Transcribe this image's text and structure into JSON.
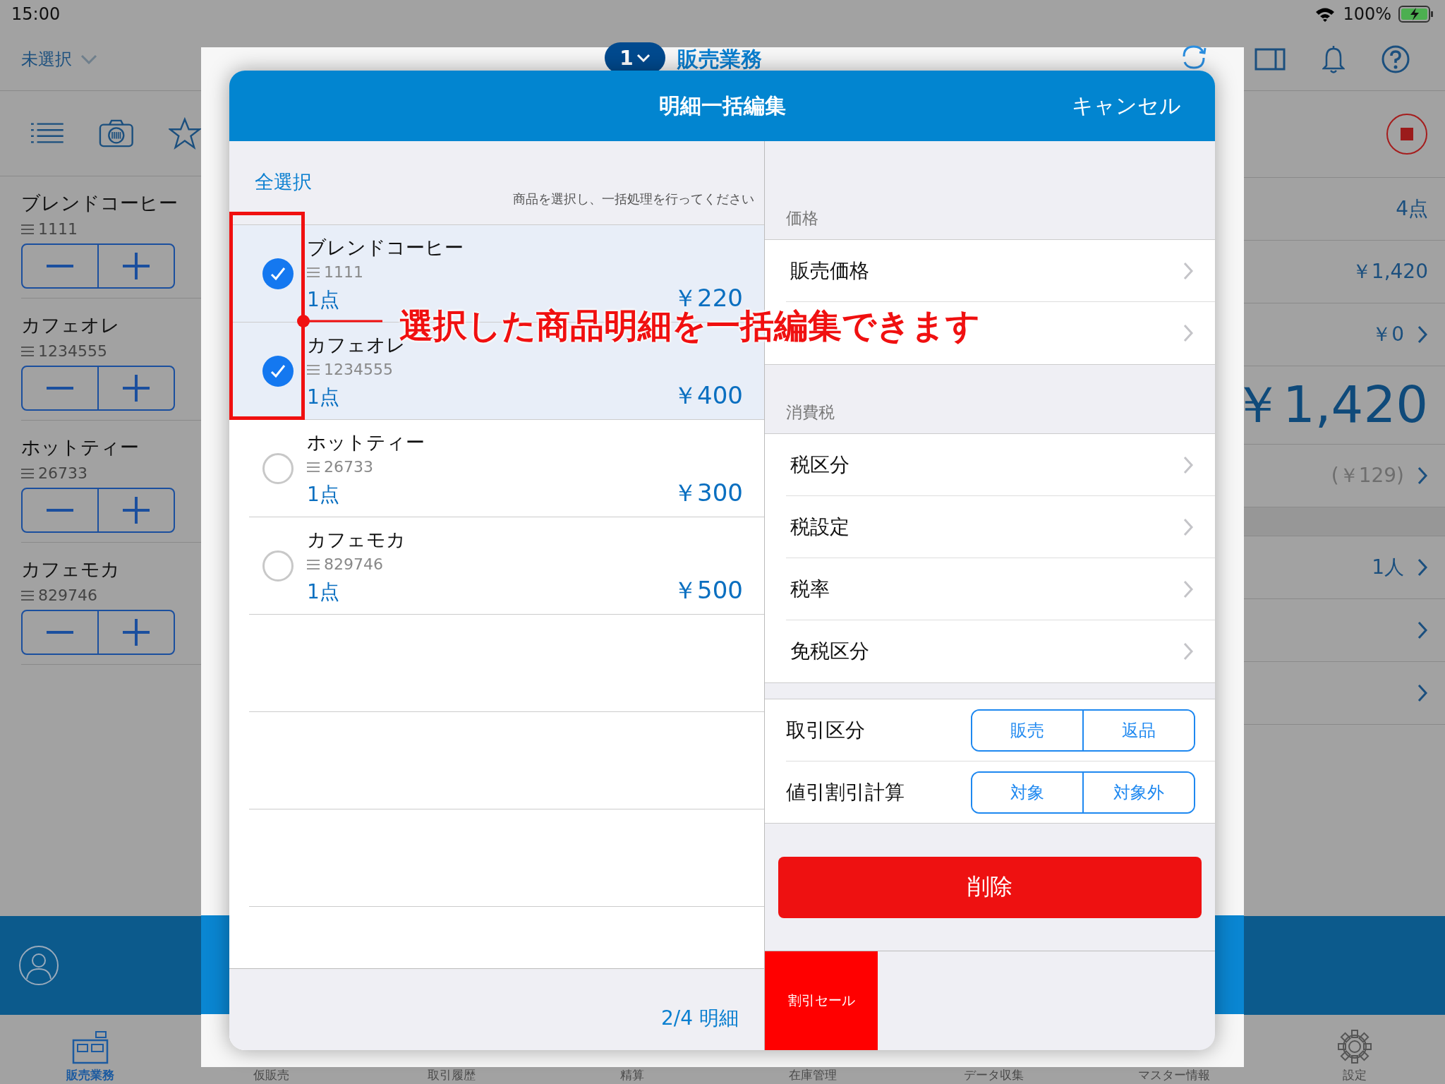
{
  "status_bar": {
    "time": "15:00",
    "battery": "100%"
  },
  "background": {
    "nav": {
      "store": "未選択",
      "register_number": "1",
      "title": "販売業務"
    },
    "items": [
      {
        "name": "ブレンドコーヒー",
        "code": "1111"
      },
      {
        "name": "カフェオレ",
        "code": "1234555"
      },
      {
        "name": "ホットティー",
        "code": "26733"
      },
      {
        "name": "カフェモカ",
        "code": "829746"
      }
    ],
    "summary": [
      {
        "kind": "plain",
        "value": "4点"
      },
      {
        "kind": "plain",
        "value": "￥1,420"
      },
      {
        "kind": "link",
        "value": "￥0"
      },
      {
        "kind": "total",
        "value": "￥1,420"
      },
      {
        "kind": "muted_link",
        "value": "(￥129)"
      },
      {
        "kind": "spacer"
      },
      {
        "kind": "link",
        "value": "1人"
      },
      {
        "kind": "link"
      },
      {
        "kind": "link"
      }
    ],
    "tabs": [
      {
        "label": "販売業務",
        "selected": true
      },
      {
        "label": "仮販売",
        "selected": false
      },
      {
        "label": "取引履歴",
        "selected": false
      },
      {
        "label": "精算",
        "selected": false
      },
      {
        "label": "在庫管理",
        "selected": false
      },
      {
        "label": "データ収集",
        "selected": false
      },
      {
        "label": "マスター情報",
        "selected": false
      },
      {
        "label": "設定",
        "selected": false
      }
    ]
  },
  "modal": {
    "title": "明細一括編集",
    "cancel": "キャンセル",
    "select_all": "全選択",
    "hint": "商品を選択し、一括処理を行ってください",
    "lines": [
      {
        "name": "ブレンドコーヒー",
        "code": "1111",
        "quantity": "1点",
        "price": "￥220",
        "selected": true
      },
      {
        "name": "カフェオレ",
        "code": "1234555",
        "quantity": "1点",
        "price": "￥400",
        "selected": true
      },
      {
        "name": "ホットティー",
        "code": "26733",
        "quantity": "1点",
        "price": "￥300",
        "selected": false
      },
      {
        "name": "カフェモカ",
        "code": "829746",
        "quantity": "1点",
        "price": "￥500",
        "selected": false
      }
    ],
    "footer": "2/4 明細",
    "sections": [
      {
        "header": "価格",
        "rows": [
          {
            "kind": "link",
            "label": "販売価格"
          },
          {
            "kind": "link"
          }
        ]
      },
      {
        "header": "消費税",
        "rows": [
          {
            "kind": "link",
            "label": "税区分"
          },
          {
            "kind": "link",
            "label": "税設定"
          },
          {
            "kind": "link",
            "label": "税率"
          },
          {
            "kind": "link",
            "label": "免税区分"
          }
        ]
      }
    ],
    "segments": [
      {
        "label": "取引区分",
        "options": [
          "販売",
          "返品"
        ]
      },
      {
        "label": "値引割引計算",
        "options": [
          "対象",
          "対象外"
        ]
      }
    ],
    "delete": "削除",
    "preset": "割引セール"
  },
  "annotation": {
    "text": "選択した商品明細を一括編集できます"
  }
}
